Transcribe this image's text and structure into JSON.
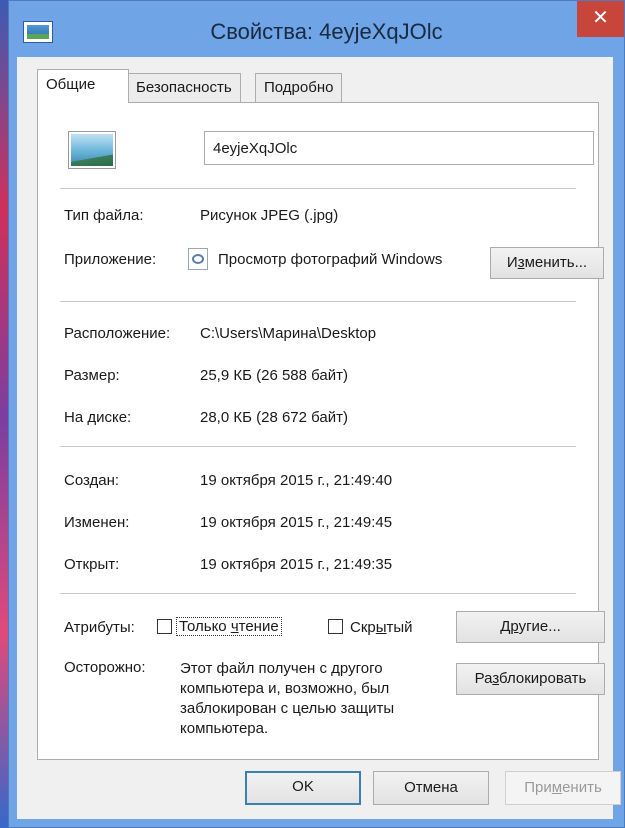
{
  "window": {
    "title": "Свойства: 4eyjeXqJOlc",
    "close_glyph": "✕"
  },
  "tabs": [
    {
      "label": "Общие"
    },
    {
      "label": "Безопасность"
    },
    {
      "label": "Подробно"
    }
  ],
  "general": {
    "file_name": "4eyjeXqJOlc",
    "file_type_label": "Тип файла:",
    "file_type_value": "Рисунок JPEG (.jpg)",
    "app_label": "Приложение:",
    "app_value": "Просмотр фотографий Windows",
    "change_button": {
      "pre": "И",
      "u": "з",
      "post": "менить..."
    },
    "location_label": "Расположение:",
    "location_value": "C:\\Users\\Марина\\Desktop",
    "size_label": "Размер:",
    "size_value": "25,9 КБ (26 588 байт)",
    "ondisk_label": "На диске:",
    "ondisk_value": "28,0 КБ (28 672 байт)",
    "created_label": "Создан:",
    "created_value": "19 октября 2015 г., 21:49:40",
    "modified_label": "Изменен:",
    "modified_value": "19 октября 2015 г., 21:49:45",
    "opened_label": "Открыт:",
    "opened_value": "19 октября 2015 г., 21:49:35",
    "attributes_label": "Атрибуты:",
    "readonly": {
      "pre": "Только ",
      "u": "ч",
      "post": "тение",
      "checked": false
    },
    "hidden": {
      "pre": "Скр",
      "u": "ы",
      "post": "тый",
      "checked": false
    },
    "other_button": {
      "pre": "Д",
      "u": "р",
      "post": "угие..."
    },
    "caution_label": "Осторожно:",
    "caution_lines": [
      "Этот файл получен с другого",
      "компьютера и, возможно, был",
      "заблокирован с целью защиты",
      "компьютера."
    ],
    "unblock_button": {
      "pre": "Ра",
      "u": "з",
      "post": "блокировать"
    }
  },
  "footer": {
    "ok": "OK",
    "cancel": "Отмена",
    "apply": {
      "pre": "При",
      "u": "м",
      "post": "енить",
      "disabled": true
    }
  },
  "colors": {
    "titlebar": "#6fa4e6",
    "close": "#c8453c",
    "client": "#f0f0f0"
  }
}
